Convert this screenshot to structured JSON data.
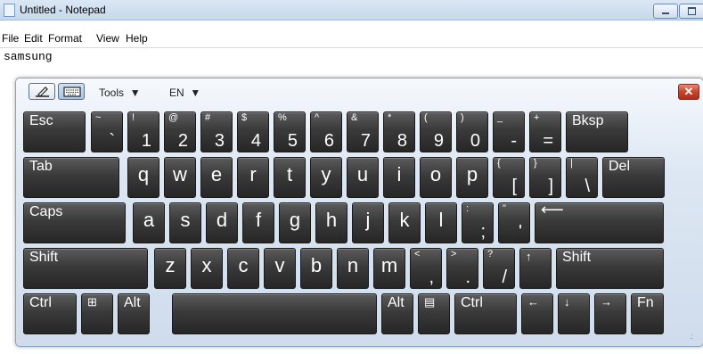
{
  "window": {
    "title": "Untitled - Notepad",
    "menu": [
      "File",
      "Edit",
      "Format",
      "View",
      "Help"
    ],
    "text": "samsung"
  },
  "osk": {
    "tools_label": "Tools",
    "lang_label": "EN",
    "close_glyph": "✕",
    "resize_glyph": ".:",
    "rows": [
      [
        {
          "label": "Esc"
        },
        {
          "shift": "~",
          "base": "`"
        },
        {
          "shift": "!",
          "base": "1"
        },
        {
          "shift": "@",
          "base": "2"
        },
        {
          "shift": "#",
          "base": "3"
        },
        {
          "shift": "$",
          "base": "4"
        },
        {
          "shift": "%",
          "base": "5"
        },
        {
          "shift": "^",
          "base": "6"
        },
        {
          "shift": "&",
          "base": "7"
        },
        {
          "shift": "*",
          "base": "8"
        },
        {
          "shift": "(",
          "base": "9"
        },
        {
          "shift": ")",
          "base": "0"
        },
        {
          "shift": "_",
          "base": "-"
        },
        {
          "shift": "+",
          "base": "="
        },
        {
          "label": "Bksp"
        }
      ],
      [
        {
          "label": "Tab"
        },
        {
          "base": "q"
        },
        {
          "base": "w"
        },
        {
          "base": "e"
        },
        {
          "base": "r"
        },
        {
          "base": "t"
        },
        {
          "base": "y"
        },
        {
          "base": "u"
        },
        {
          "base": "i"
        },
        {
          "base": "o"
        },
        {
          "base": "p"
        },
        {
          "shift": "{",
          "base": "["
        },
        {
          "shift": "}",
          "base": "]"
        },
        {
          "shift": "|",
          "base": "\\"
        },
        {
          "label": "Del"
        }
      ],
      [
        {
          "label": "Caps"
        },
        {
          "base": "a"
        },
        {
          "base": "s"
        },
        {
          "base": "d"
        },
        {
          "base": "f"
        },
        {
          "base": "g"
        },
        {
          "base": "h"
        },
        {
          "base": "j"
        },
        {
          "base": "k"
        },
        {
          "base": "l"
        },
        {
          "shift": ":",
          "base": ";"
        },
        {
          "shift": "\"",
          "base": "'"
        },
        {
          "label": "⟵"
        }
      ],
      [
        {
          "label": "Shift"
        },
        {
          "base": "z"
        },
        {
          "base": "x"
        },
        {
          "base": "c"
        },
        {
          "base": "v"
        },
        {
          "base": "b"
        },
        {
          "base": "n"
        },
        {
          "base": "m"
        },
        {
          "shift": "<",
          "base": ","
        },
        {
          "shift": ">",
          "base": "."
        },
        {
          "shift": "?",
          "base": "/"
        },
        {
          "label": "↑"
        },
        {
          "label": "Shift"
        }
      ],
      [
        {
          "label": "Ctrl"
        },
        {
          "label": "⊞"
        },
        {
          "label": "Alt"
        },
        {
          "label": ""
        },
        {
          "label": "Alt"
        },
        {
          "label": "▤"
        },
        {
          "label": "Ctrl"
        },
        {
          "label": "←"
        },
        {
          "label": "↓"
        },
        {
          "label": "→"
        },
        {
          "label": "Fn"
        }
      ]
    ]
  }
}
